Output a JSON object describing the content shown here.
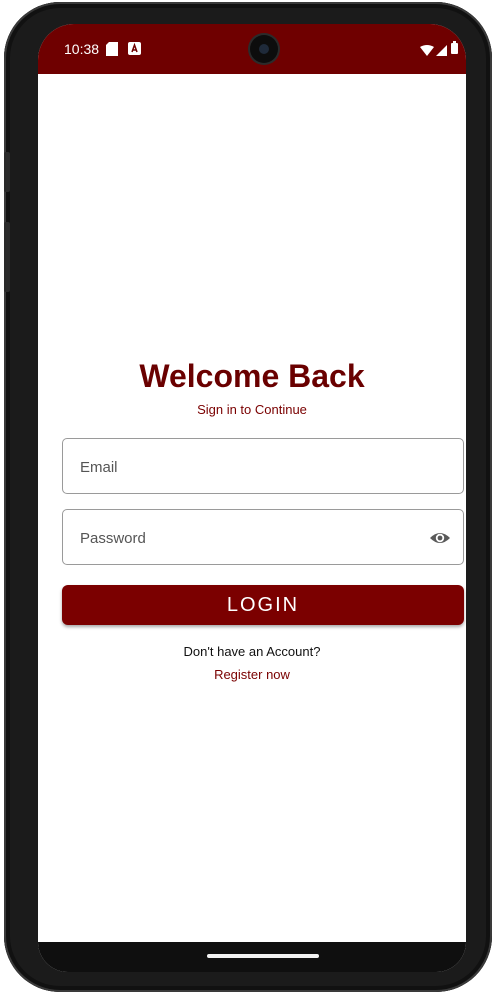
{
  "status_bar": {
    "time": "10:38",
    "notification_icons": [
      "sd-card-icon",
      "app-notification-icon"
    ],
    "system_icons": [
      "wifi-icon",
      "signal-icon",
      "battery-icon"
    ],
    "background_color": "#6f0000"
  },
  "login_screen": {
    "title": "Welcome Back",
    "subtitle": "Sign in to Continue",
    "email_placeholder": "Email",
    "password_placeholder": "Password",
    "login_label": "LOGIN",
    "no_account_text": "Don't have an Account?",
    "register_label": "Register now"
  },
  "colors": {
    "primary": "#7b0000",
    "title": "#6a0000",
    "border": "#9a9a9a"
  }
}
